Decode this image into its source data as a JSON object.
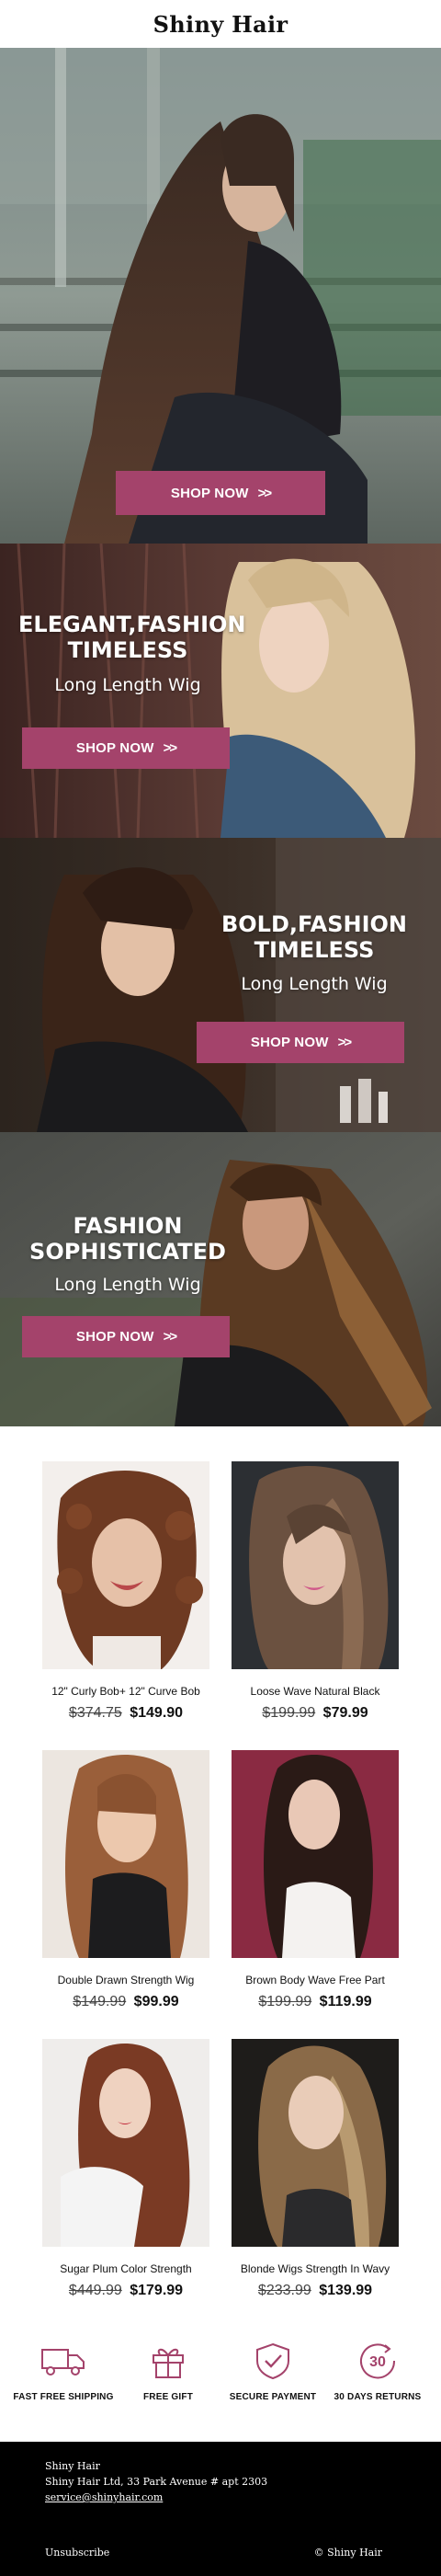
{
  "brand": {
    "name": "Shiny Hair"
  },
  "colors": {
    "accent": "#a4436b",
    "footer_bg": "#000000"
  },
  "heroes": [
    {
      "title": "",
      "subtitle": "",
      "button": "SHOP NOW",
      "button_icon": "double-chevron-right-icon"
    },
    {
      "title": "ELEGANT,FASHION TIMELESS",
      "subtitle": "Long Length Wig",
      "button": "SHOP NOW",
      "button_icon": "double-chevron-right-icon"
    },
    {
      "title": "BOLD,FASHION TIMELESS",
      "subtitle": "Long Length Wig",
      "button": "SHOP NOW",
      "button_icon": "double-chevron-right-icon"
    },
    {
      "title": "FASHION SOPHISTICATED",
      "subtitle": "Long Length Wig",
      "button": "SHOP NOW",
      "button_icon": "double-chevron-right-icon"
    }
  ],
  "products": [
    {
      "name": "12\" Curly Bob+ 12\" Curve Bob",
      "old_price": "$374.75",
      "price": "$149.90"
    },
    {
      "name": "Loose Wave Natural Black",
      "old_price": "$199.99",
      "price": "$79.99"
    },
    {
      "name": "Double Drawn Strength Wig",
      "old_price": "$149.99",
      "price": "$99.99"
    },
    {
      "name": "Brown Body Wave Free Part",
      "old_price": "$199.99",
      "price": "$119.99"
    },
    {
      "name": "Sugar Plum Color Strength",
      "old_price": "$449.99",
      "price": "$179.99"
    },
    {
      "name": "Blonde Wigs Strength In Wavy",
      "old_price": "$233.99",
      "price": "$139.99"
    }
  ],
  "features": [
    {
      "label": "FAST FREE SHIPPING",
      "icon": "truck-icon"
    },
    {
      "label": "FREE GIFT",
      "icon": "gift-icon"
    },
    {
      "label": "SECURE PAYMENT",
      "icon": "shield-check-icon"
    },
    {
      "label": "30 DAYS RETURNS",
      "icon": "returns-30-icon",
      "badge": "30"
    }
  ],
  "footer": {
    "company": "Shiny Hair",
    "address": "Shiny Hair Ltd, 33 Park Avenue # apt 2303",
    "email": "service@shinyhair.com",
    "unsubscribe": "Unsubscribe",
    "copyright": "© Shiny Hair"
  }
}
